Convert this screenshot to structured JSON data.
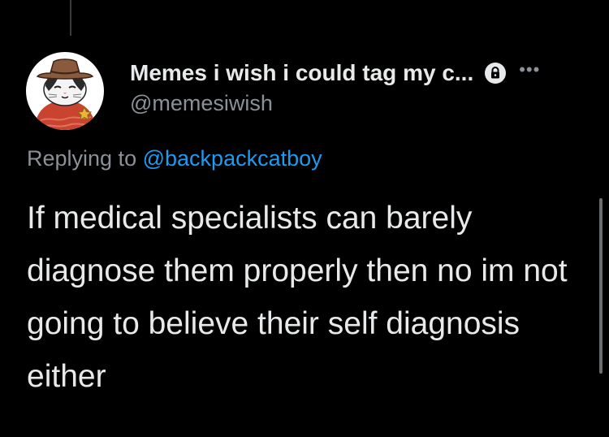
{
  "author": {
    "display_name": "Memes i wish i could tag my c...",
    "handle": "@memesiwish",
    "avatar_icon": "cowboy-cat-avatar",
    "protected_icon": "lock-icon"
  },
  "more_icon": "more-dots-icon",
  "more_glyph": "•••",
  "reply": {
    "prefix": "Replying to",
    "target": "@backpackcatboy"
  },
  "tweet": {
    "text": "If medical specialists can barely diagnose them properly then no im not going to believe their self diagnosis either"
  },
  "colors": {
    "background": "#000000",
    "text": "#e7e9ea",
    "secondary": "#8b9197",
    "link": "#1d9bf0"
  }
}
